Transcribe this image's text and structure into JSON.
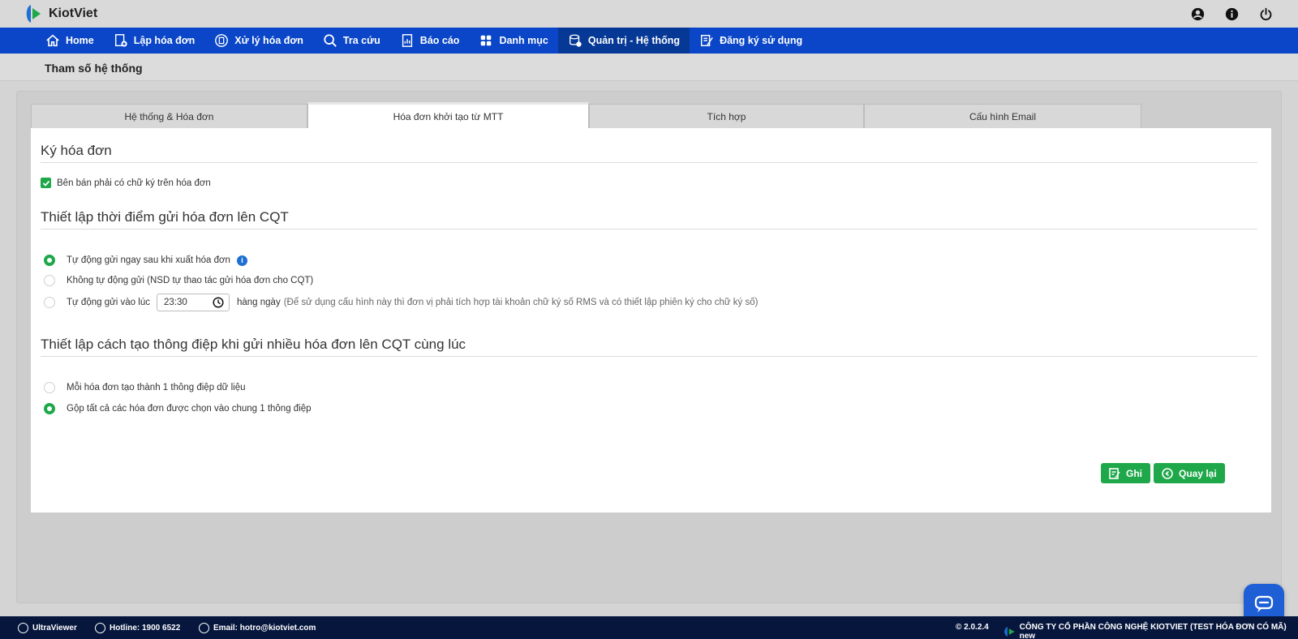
{
  "app": {
    "logo_text": "KiotViet"
  },
  "top_icons": [
    "user-circle-icon",
    "info-icon",
    "power-icon"
  ],
  "nav": [
    {
      "label": "Home",
      "icon": "home-icon"
    },
    {
      "label": "Lập hóa đơn",
      "icon": "create-invoice-icon"
    },
    {
      "label": "Xử lý hóa đơn",
      "icon": "process-invoice-icon"
    },
    {
      "label": "Tra cứu",
      "icon": "search-icon"
    },
    {
      "label": "Báo cáo",
      "icon": "report-icon"
    },
    {
      "label": "Danh mục",
      "icon": "grid-icon"
    },
    {
      "label": "Quản trị - Hệ thống",
      "icon": "admin-icon",
      "active": true
    },
    {
      "label": "Đăng ký sử dụng",
      "icon": "register-icon"
    }
  ],
  "page": {
    "title": "Tham số hệ thống"
  },
  "tabs": [
    {
      "label": "Hệ thống & Hóa đơn"
    },
    {
      "label": "Hóa đơn khởi tạo từ MTT",
      "active": true
    },
    {
      "label": "Tích hợp"
    },
    {
      "label": "Cấu hình Email"
    }
  ],
  "sign": {
    "title": "Ký hóa đơn",
    "checkbox_label": "Bên bán phải có chữ ký trên hóa đơn",
    "checked": true
  },
  "send_time": {
    "title": "Thiết lập thời điểm gửi hóa đơn lên CQT",
    "options": [
      {
        "label": "Tự động gửi ngay sau khi xuất hóa đơn",
        "selected": true
      },
      {
        "label": "Không tự động gửi (NSD tự thao tác gửi hóa đơn cho CQT)",
        "selected": false
      },
      {
        "label": "Tự động gửi vào lúc",
        "selected": false
      }
    ],
    "time_value": "23:30",
    "daily_label": "hàng ngày",
    "hint": "(Để sử dụng cấu hình này thì đơn vị phải tích hợp tài khoản chữ ký số RMS và có thiết lập phiên ký cho chữ ký số)"
  },
  "message": {
    "title": "Thiết lập cách tạo thông điệp khi gửi nhiều hóa đơn lên CQT cùng lúc",
    "options": [
      {
        "label": "Mỗi hóa đơn tạo thành 1 thông điệp dữ liệu",
        "selected": false
      },
      {
        "label": "Gộp tất cả các hóa đơn được chọn vào chung 1 thông điệp",
        "selected": true
      }
    ]
  },
  "buttons": {
    "save": "Ghi",
    "back": "Quay lại"
  },
  "footer": {
    "ultraviewer": "UltraViewer",
    "hotline": "Hotline: 1900 6522",
    "email": "Email: hotro@kiotviet.com",
    "version": "© 2.0.2.4",
    "company": "CÔNG TY CỔ PHẦN CÔNG NGHỆ KIOTVIET (TEST HÓA ĐƠN CÓ MÃ) new"
  },
  "colors": {
    "nav_bg": "#0a46c7",
    "nav_active": "#063896",
    "accent_green": "#1fa84a",
    "footer_bg": "#06163d"
  }
}
